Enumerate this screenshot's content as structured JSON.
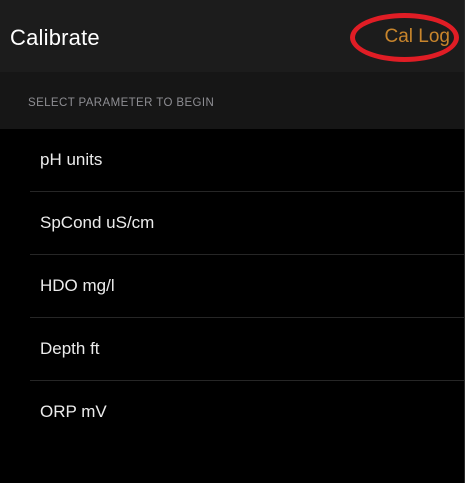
{
  "nav": {
    "title": "Calibrate",
    "action_label": "Cal Log"
  },
  "section": {
    "header": "SELECT PARAMETER TO BEGIN"
  },
  "parameters": [
    {
      "label": "pH units"
    },
    {
      "label": "SpCond uS/cm"
    },
    {
      "label": "HDO mg/l"
    },
    {
      "label": "Depth ft"
    },
    {
      "label": "ORP mV"
    }
  ],
  "colors": {
    "accent": "#c8852c",
    "highlight_ring": "#e01d25",
    "background": "#000000"
  }
}
